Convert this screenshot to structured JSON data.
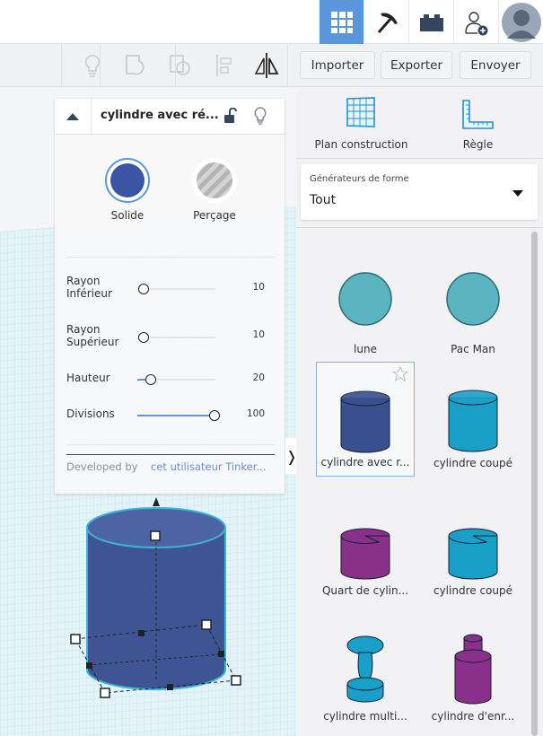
{
  "topbar": {
    "icons": [
      "grid-view-icon",
      "tinker-pickaxe-icon",
      "bricks-icon",
      "add-user-icon",
      "avatar"
    ],
    "accent": "#5b96db"
  },
  "toolbar": {
    "import_label": "Importer",
    "export_label": "Exporter",
    "send_label": "Envoyer"
  },
  "inspector": {
    "title": "cylindre avec ré...",
    "solid_label": "Solide",
    "hole_label": "Perçage",
    "params": [
      {
        "label1": "Rayon",
        "label2": "Inférieur",
        "value": "10",
        "fraction": 0.0
      },
      {
        "label1": "Rayon",
        "label2": "Supérieur",
        "value": "10",
        "fraction": 0.0
      },
      {
        "label1": "Hauteur",
        "label2": "",
        "value": "20",
        "fraction": 0.16
      },
      {
        "label1": "Divisions",
        "label2": "",
        "value": "100",
        "fraction": 1.0
      }
    ],
    "developed_by": "Developed by",
    "author": "cet utilisateur Tinker..."
  },
  "right": {
    "workplane_label": "Plan construction",
    "ruler_label": "Règle",
    "dropdown_label": "Générateurs de forme",
    "dropdown_value": "Tout",
    "shapes": [
      {
        "name": "lune",
        "color": "#5bb5c0",
        "kind": "sphere"
      },
      {
        "name": "Pac Man",
        "color": "#5bb5c0",
        "kind": "sphere"
      },
      {
        "name": "cylindre avec r...",
        "color": "#3a4f8f",
        "kind": "cyl",
        "selected": true
      },
      {
        "name": "cylindre coupé",
        "color": "#1aa0c8",
        "kind": "cyl"
      },
      {
        "name": "Quart de cylin...",
        "color": "#8a2f8a",
        "kind": "cut"
      },
      {
        "name": "cylindre coupé",
        "color": "#1aa0c8",
        "kind": "cut"
      },
      {
        "name": "cylindre multi...",
        "color": "#1aa0c8",
        "kind": "multi"
      },
      {
        "name": "cylindre d'enr...",
        "color": "#8a2f8a",
        "kind": "stack"
      }
    ]
  }
}
